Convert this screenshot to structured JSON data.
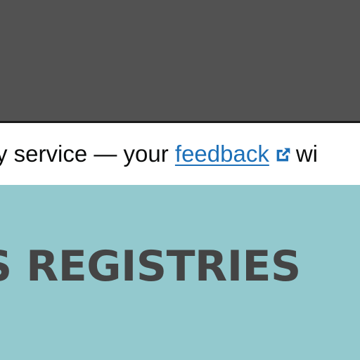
{
  "beta_banner": {
    "text_before": "y service — your ",
    "link_text": "feedback",
    "link_icon": "external-link-icon",
    "text_after": "wi"
  },
  "hero": {
    "title": "S REGISTRIES"
  },
  "colors": {
    "header_bg": "#525252",
    "banner_bg": "#ffffff",
    "link": "#1d70b8",
    "hero_bg": "#93c9ce",
    "hero_text": "#444444"
  }
}
